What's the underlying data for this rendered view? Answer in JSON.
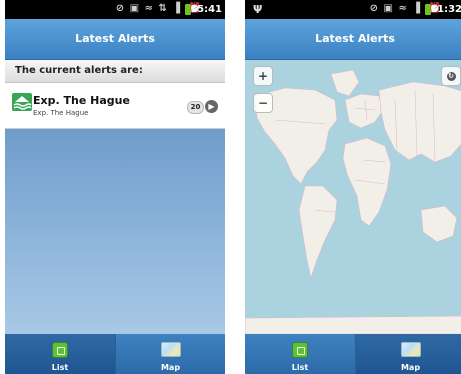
{
  "left_phone": {
    "status": {
      "time": "15:41",
      "icons": "⊘ ▣ ≈ ⇅ ▐"
    },
    "header": {
      "title": "Latest Alerts"
    },
    "subheader": {
      "text": "The current alerts are:"
    },
    "alerts": [
      {
        "title": "Exp. The Hague",
        "subtitle": "Exp. The Hague",
        "count": "20",
        "icon": "wave-alert-icon"
      }
    ],
    "tabs": [
      {
        "label": "List",
        "icon": "list-icon",
        "active": true
      },
      {
        "label": "Map",
        "icon": "map-icon",
        "active": false
      }
    ]
  },
  "right_phone": {
    "status": {
      "time": "11:32",
      "usb": "Ψ",
      "icons": "⊘ ▣ ≈ ▐"
    },
    "header": {
      "title": "Latest Alerts"
    },
    "map_controls": {
      "zoom_in": "+",
      "zoom_out": "−",
      "refresh": "↻"
    },
    "tabs": [
      {
        "label": "List",
        "icon": "list-icon",
        "active": false
      },
      {
        "label": "Map",
        "icon": "map-icon",
        "active": true
      }
    ]
  },
  "colors": {
    "header_blue": "#3b82c3",
    "map_water": "#aad3df",
    "map_land": "#f2efe9",
    "battery_green": "#6ec21f",
    "alert_green": "#3aa655"
  }
}
